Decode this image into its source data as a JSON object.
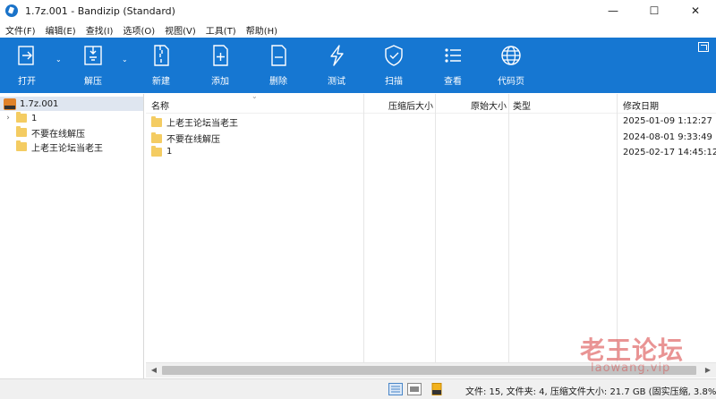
{
  "window": {
    "title": "1.7z.001 - Bandizip (Standard)",
    "controls": {
      "minimize": "—",
      "maximize": "☐",
      "close": "✕"
    }
  },
  "menu": [
    "文件(F)",
    "编辑(E)",
    "查找(I)",
    "选项(O)",
    "视图(V)",
    "工具(T)",
    "帮助(H)"
  ],
  "toolbar": {
    "accent": "#1677d2",
    "buttons": [
      {
        "id": "open",
        "label": "打开",
        "icon": "open-icon"
      },
      {
        "id": "extract",
        "label": "解压",
        "icon": "extract-icon"
      },
      {
        "id": "new",
        "label": "新建",
        "icon": "new-archive-icon"
      },
      {
        "id": "add",
        "label": "添加",
        "icon": "add-file-icon"
      },
      {
        "id": "delete",
        "label": "删除",
        "icon": "delete-file-icon"
      },
      {
        "id": "test",
        "label": "测试",
        "icon": "test-icon"
      },
      {
        "id": "scan",
        "label": "扫描",
        "icon": "shield-icon"
      },
      {
        "id": "view",
        "label": "查看",
        "icon": "list-icon"
      },
      {
        "id": "codepage",
        "label": "代码页",
        "icon": "globe-icon"
      }
    ]
  },
  "tree": {
    "root": "1.7z.001",
    "items": [
      {
        "label": "1",
        "expandable": true
      },
      {
        "label": "不要在线解压",
        "expandable": false
      },
      {
        "label": "上老王论坛当老王",
        "expandable": false
      }
    ]
  },
  "columns": {
    "name": "名称",
    "packed_size": "压缩后大小",
    "original_size": "原始大小",
    "type": "类型",
    "modified": "修改日期"
  },
  "files": [
    {
      "name": "上老王论坛当老王",
      "modified": "2025-01-09 1:12:27"
    },
    {
      "name": "不要在线解压",
      "modified": "2024-08-01 9:33:49"
    },
    {
      "name": "1",
      "modified": "2025-02-17 14:45:12"
    }
  ],
  "status": {
    "text": "文件: 15, 文件夹: 4, 压缩文件大小: 21.7 GB (固实压缩, 3.8%)"
  },
  "watermark": {
    "title": "老王论坛",
    "subtitle": "laowang.vip"
  }
}
